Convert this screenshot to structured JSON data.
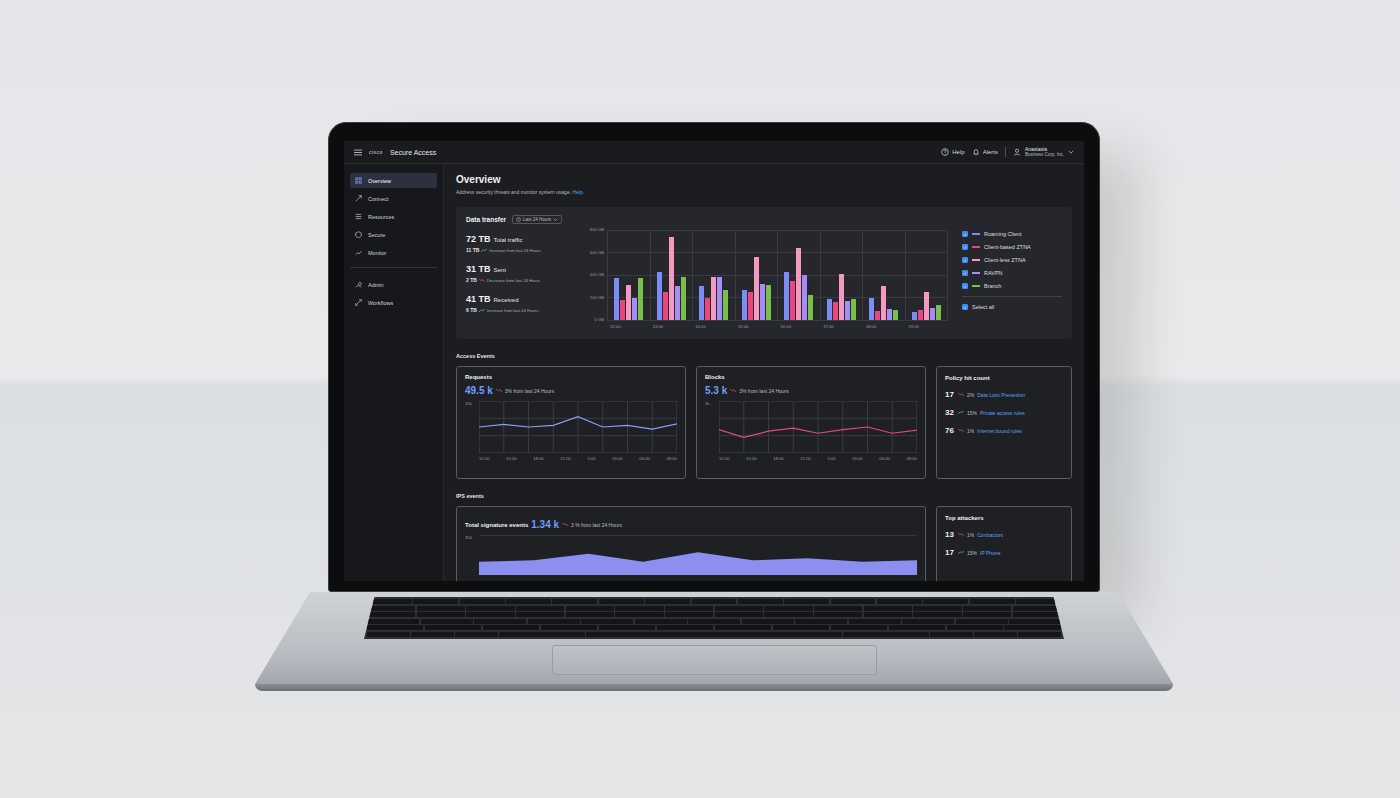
{
  "app": {
    "logo": "cisco",
    "title": "Secure Access"
  },
  "topbar": {
    "help": "Help",
    "alerts": "Alerts",
    "user_name": "Anastasia",
    "user_org": "Business Corp, Inc."
  },
  "sidebar": {
    "groups": [
      [
        {
          "label": "Overview",
          "selected": true
        },
        {
          "label": "Connect",
          "selected": false
        },
        {
          "label": "Resources",
          "selected": false
        },
        {
          "label": "Secure",
          "selected": false
        },
        {
          "label": "Monitor",
          "selected": false
        }
      ],
      [
        {
          "label": "Admin",
          "selected": false
        },
        {
          "label": "Workflows",
          "selected": false
        }
      ]
    ]
  },
  "page": {
    "title": "Overview",
    "subtitle": "Address security threats and monitor system usage.",
    "help_link": "Help."
  },
  "data_transfer": {
    "title": "Data transfer",
    "range": "Last 24 Hours",
    "stats": [
      {
        "value": "72 TB",
        "label": "Total traffic",
        "delta": "11 TB",
        "trend": "up",
        "note": "Increase from last 24 Hours"
      },
      {
        "value": "31 TB",
        "label": "Sent",
        "delta": "2 TB",
        "trend": "down",
        "note": "Decrease from last 24 Hours"
      },
      {
        "value": "41 TB",
        "label": "Received",
        "delta": "6 TB",
        "trend": "up",
        "note": "Increase from last 24 Hours"
      }
    ],
    "chart": {
      "y_ticks": [
        "800 GB",
        "600 GB",
        "400 GB",
        "200 GB",
        "0 GB"
      ],
      "y_max": 800,
      "x_ticks": [
        "12:00",
        "13:00",
        "14:00",
        "15:00",
        "16:00",
        "17:00",
        "18:00",
        "19:00"
      ],
      "series": [
        {
          "name": "Roaming Client",
          "color": "#7b8df2",
          "checked": true,
          "values": [
            370,
            430,
            300,
            270,
            430,
            190,
            200,
            70
          ]
        },
        {
          "name": "Client-based ZTNA",
          "color": "#e8467c",
          "checked": true,
          "values": [
            180,
            250,
            200,
            250,
            350,
            160,
            80,
            90
          ]
        },
        {
          "name": "Client-less ZTNA",
          "color": "#f49ac1",
          "checked": true,
          "values": [
            310,
            740,
            380,
            560,
            640,
            410,
            300,
            250
          ]
        },
        {
          "name": "RAVPN",
          "color": "#a68cf5",
          "checked": true,
          "values": [
            200,
            300,
            380,
            320,
            400,
            170,
            100,
            110
          ]
        },
        {
          "name": "Branch",
          "color": "#78c04a",
          "checked": true,
          "values": [
            370,
            380,
            270,
            310,
            220,
            190,
            90,
            130
          ]
        }
      ]
    },
    "select_all": {
      "label": "Select all",
      "checked": true
    }
  },
  "access_events": {
    "title": "Access Events",
    "requests": {
      "title": "Requests",
      "value": "49.5 k",
      "change": "3% from last 24 Hours",
      "trend": "down",
      "y_tick": "10k",
      "y_max": 10,
      "x_ticks": [
        "12:00",
        "15:00",
        "18:00",
        "21:00",
        "0:00",
        "03:00",
        "06:00",
        "09:00"
      ],
      "values": [
        5.0,
        5.5,
        5.0,
        5.3,
        7.0,
        5.0,
        5.3,
        4.6,
        5.6
      ]
    },
    "blocks": {
      "title": "Blocks",
      "value": "5.3 k",
      "change": "3% from last 24 Hours",
      "trend": "down",
      "y_tick": "1k",
      "y_max": 1,
      "x_ticks": [
        "12:00",
        "15:00",
        "18:00",
        "21:00",
        "0:00",
        "03:00",
        "06:00",
        "09:00"
      ],
      "values": [
        0.45,
        0.3,
        0.42,
        0.48,
        0.38,
        0.45,
        0.5,
        0.38,
        0.44
      ]
    },
    "policy_hit_count": {
      "title": "Policy hit count",
      "rows": [
        {
          "count": "17",
          "pct": "2%",
          "label": "Data Loss Prevention",
          "trend": "down"
        },
        {
          "count": "32",
          "pct": "15%",
          "label": "Private access rules",
          "trend": "up"
        },
        {
          "count": "76",
          "pct": "1%",
          "label": "Internet bound rules",
          "trend": "down"
        }
      ]
    }
  },
  "ips_events": {
    "title": "IPS events",
    "signatures": {
      "title": "Total signature events",
      "value": "1.34 k",
      "change": "3 % from last 24 Hours",
      "trend": "down",
      "y_tick": "300",
      "y_max": 300,
      "values": [
        100,
        110,
        160,
        100,
        170,
        110,
        125,
        100,
        110
      ]
    },
    "top_attackers": {
      "title": "Top attackers",
      "rows": [
        {
          "count": "13",
          "pct": "1%",
          "label": "Contractors",
          "trend": "down"
        },
        {
          "count": "17",
          "pct": "15%",
          "label": "IP Phone",
          "trend": "up"
        }
      ]
    }
  }
}
